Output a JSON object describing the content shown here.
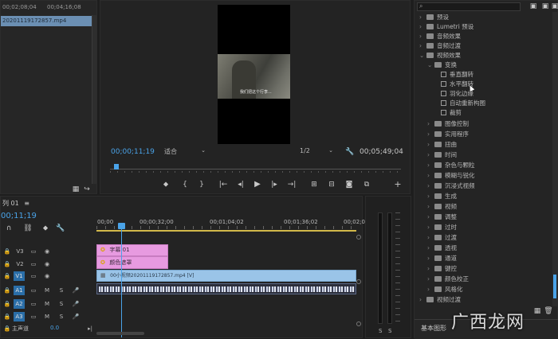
{
  "project": {
    "timecode_left": "00;02;08;04",
    "timecode_right": "00;04;16;08",
    "file_item": "20201119172857.mp4"
  },
  "program": {
    "timecode": "00;00;11;19",
    "fit_label": "适合",
    "quality_label": "1/2",
    "duration": "00;05;49;04",
    "caption_text": "我们把这个行李..."
  },
  "timeline": {
    "tab_label": "列 01",
    "menu_icon": "≡",
    "timecode": "00;11;19",
    "ruler": [
      "00;00",
      "00;00;32;00",
      "00;01;04;02",
      "00;01;36;02",
      "00;02;08;04"
    ],
    "tracks": [
      {
        "lock": "🔒",
        "label": "V3"
      },
      {
        "lock": "🔒",
        "label": "V2"
      },
      {
        "lock": "🔒",
        "label": "V1"
      },
      {
        "lock": "🔒",
        "label": "A1",
        "m": "M",
        "s": "S"
      },
      {
        "lock": "🔒",
        "label": "A2",
        "m": "M",
        "s": "S"
      },
      {
        "lock": "🔒",
        "label": "A3",
        "m": "M",
        "s": "S"
      }
    ],
    "master_label": "主声道",
    "master_value": "0.0",
    "clips": {
      "v3": "字幕 01",
      "v2": "颜色遮罩",
      "v1": "00小视频20201119172857.mp4 [V]"
    }
  },
  "meter": {
    "s1": "S",
    "s2": "S"
  },
  "effects": {
    "search_placeholder": "",
    "items": [
      {
        "type": "folder",
        "label": "预设",
        "level": 0,
        "arrow": "›"
      },
      {
        "type": "folder",
        "label": "Lumetri 预设",
        "level": 0,
        "arrow": "›"
      },
      {
        "type": "folder",
        "label": "音频效果",
        "level": 0,
        "arrow": "›"
      },
      {
        "type": "folder",
        "label": "音频过渡",
        "level": 0,
        "arrow": "›"
      },
      {
        "type": "folder",
        "label": "视频效果",
        "level": 0,
        "arrow": "⌄"
      },
      {
        "type": "folder",
        "label": "变换",
        "level": 1,
        "arrow": "⌄"
      },
      {
        "type": "fx",
        "label": "垂直翻转",
        "level": 2,
        "arrow": ""
      },
      {
        "type": "fx",
        "label": "水平翻转",
        "level": 2,
        "arrow": ""
      },
      {
        "type": "fx",
        "label": "羽化边缘",
        "level": 2,
        "arrow": ""
      },
      {
        "type": "fx",
        "label": "自动重新构图",
        "level": 2,
        "arrow": ""
      },
      {
        "type": "fx",
        "label": "裁剪",
        "level": 2,
        "arrow": ""
      },
      {
        "type": "folder",
        "label": "图像控制",
        "level": 1,
        "arrow": "›"
      },
      {
        "type": "folder",
        "label": "实用程序",
        "level": 1,
        "arrow": "›"
      },
      {
        "type": "folder",
        "label": "扭曲",
        "level": 1,
        "arrow": "›"
      },
      {
        "type": "folder",
        "label": "时间",
        "level": 1,
        "arrow": "›"
      },
      {
        "type": "folder",
        "label": "杂色与颗粒",
        "level": 1,
        "arrow": "›"
      },
      {
        "type": "folder",
        "label": "模糊与锐化",
        "level": 1,
        "arrow": "›"
      },
      {
        "type": "folder",
        "label": "沉浸式视频",
        "level": 1,
        "arrow": "›"
      },
      {
        "type": "folder",
        "label": "生成",
        "level": 1,
        "arrow": "›"
      },
      {
        "type": "folder",
        "label": "视频",
        "level": 1,
        "arrow": "›"
      },
      {
        "type": "folder",
        "label": "调整",
        "level": 1,
        "arrow": "›"
      },
      {
        "type": "folder",
        "label": "过时",
        "level": 1,
        "arrow": "›"
      },
      {
        "type": "folder",
        "label": "过渡",
        "level": 1,
        "arrow": "›"
      },
      {
        "type": "folder",
        "label": "透视",
        "level": 1,
        "arrow": "›"
      },
      {
        "type": "folder",
        "label": "通道",
        "level": 1,
        "arrow": "›"
      },
      {
        "type": "folder",
        "label": "键控",
        "level": 1,
        "arrow": "›"
      },
      {
        "type": "folder",
        "label": "颜色校正",
        "level": 1,
        "arrow": "›"
      },
      {
        "type": "folder",
        "label": "风格化",
        "level": 1,
        "arrow": "›"
      },
      {
        "type": "folder",
        "label": "视频过渡",
        "level": 0,
        "arrow": "›"
      }
    ],
    "bottom_label": "基本图形",
    "watermark": "广西龙网"
  }
}
